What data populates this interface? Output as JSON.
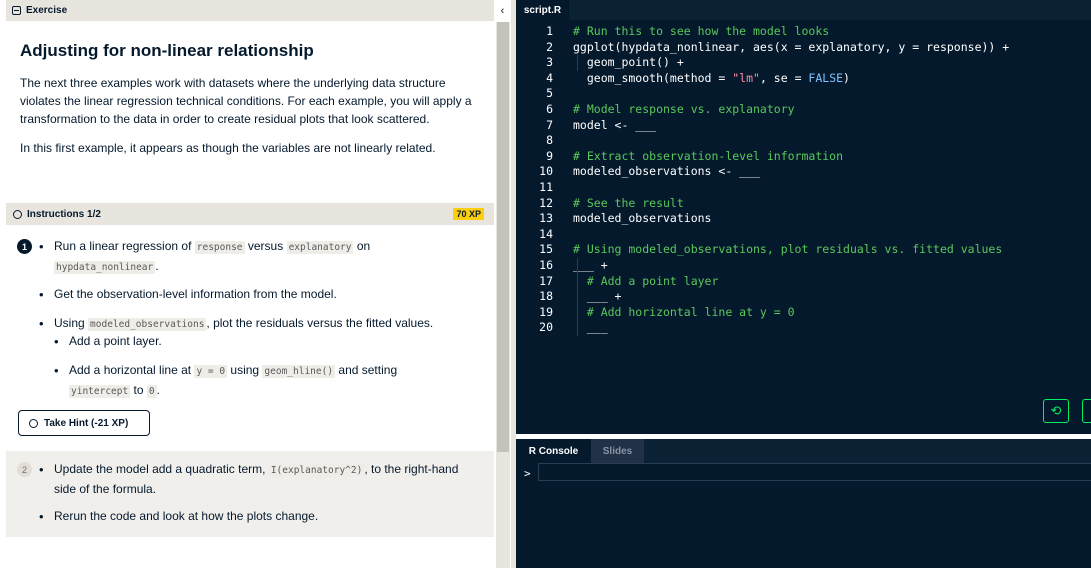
{
  "exercise": {
    "header_label": "Exercise",
    "title": "Adjusting for non-linear relationship",
    "paragraph1": "The next three examples work with datasets where the underlying data structure violates the linear regression technical conditions. For each example, you will apply a transformation to the data in order to create residual plots that look scattered.",
    "paragraph2": "In this first example, it appears as though the variables are not linearly related."
  },
  "instructions": {
    "header_label": "Instructions 1/2",
    "xp": "70 XP",
    "step1_number": "1",
    "step1": {
      "b1_pre": "Run a linear regression of",
      "b1_code1": "response",
      "b1_mid": "versus",
      "b1_code2": "explanatory",
      "b1_post": "on",
      "b1_code3": "hypdata_nonlinear",
      "b1_end": ".",
      "b2": "Get the observation-level information from the model.",
      "b3_pre": "Using",
      "b3_code": "modeled_observations",
      "b3_post": ", plot the residuals versus the fitted values.",
      "b3a": "Add a point layer.",
      "b3b_pre": "Add a horizontal line at",
      "b3b_code1": "y = 0",
      "b3b_mid": "using",
      "b3b_code2": "geom_hline()",
      "b3b_post": "and setting",
      "b3b_code3": "yintercept",
      "b3b_to": "to",
      "b3b_code4": "0",
      "b3b_end": "."
    },
    "hint_label": "Take Hint (-21 XP)",
    "step2_number": "2",
    "step2": {
      "b1_pre": "Update the model add a quadratic term,",
      "b1_code": "I(explanatory^2)",
      "b1_post": ", to the right-hand side of the formula.",
      "b2": "Rerun the code and look at how the plots change."
    }
  },
  "editor": {
    "tab_label": "script.R",
    "lines": [
      {
        "n": "1",
        "text": "# Run this to see how the model looks"
      },
      {
        "n": "2",
        "text": "ggplot(hypdata_nonlinear, aes(x = explanatory, y = response)) +"
      },
      {
        "n": "3",
        "text": "  geom_point() +"
      },
      {
        "n": "4",
        "pre": "  geom_smooth(method = ",
        "str": "\"lm\"",
        "mid": ", se = ",
        "kw": "FALSE",
        "post": ")"
      },
      {
        "n": "5",
        "text": ""
      },
      {
        "n": "6",
        "text": "# Model response vs. explanatory"
      },
      {
        "n": "7",
        "text": "model <- ___"
      },
      {
        "n": "8",
        "text": ""
      },
      {
        "n": "9",
        "text": "# Extract observation-level information"
      },
      {
        "n": "10",
        "text": "modeled_observations <- ___"
      },
      {
        "n": "11",
        "text": ""
      },
      {
        "n": "12",
        "text": "# See the result"
      },
      {
        "n": "13",
        "text": "modeled_observations"
      },
      {
        "n": "14",
        "text": ""
      },
      {
        "n": "15",
        "text": "# Using modeled_observations, plot residuals vs. fitted values"
      },
      {
        "n": "16",
        "text": "___ +"
      },
      {
        "n": "17",
        "text": "  # Add a point layer"
      },
      {
        "n": "18",
        "text": "  ___ +"
      },
      {
        "n": "19",
        "text": "  # Add horizontal line at y = 0"
      },
      {
        "n": "20",
        "text": "  ___"
      }
    ]
  },
  "console": {
    "tab_console": "R Console",
    "tab_slides": "Slides",
    "prompt": ">"
  },
  "icons": {
    "collapse": "chevron-left-icon",
    "reset": "reset-icon"
  }
}
